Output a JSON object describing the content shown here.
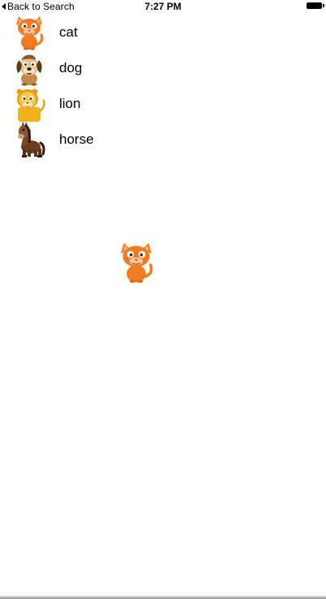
{
  "status_bar": {
    "back_label": "Back to Search",
    "time": "7:27 PM"
  },
  "animals": [
    {
      "label": "cat",
      "icon": "cat-icon"
    },
    {
      "label": "dog",
      "icon": "dog-icon"
    },
    {
      "label": "lion",
      "icon": "lion-icon"
    },
    {
      "label": "horse",
      "icon": "horse-icon"
    }
  ],
  "selected_animal": {
    "icon": "cat-icon"
  },
  "colors": {
    "cat": "#f47a1f",
    "dog": "#8b5a2b",
    "lion": "#f2b11c",
    "horse": "#6b3d1f"
  }
}
